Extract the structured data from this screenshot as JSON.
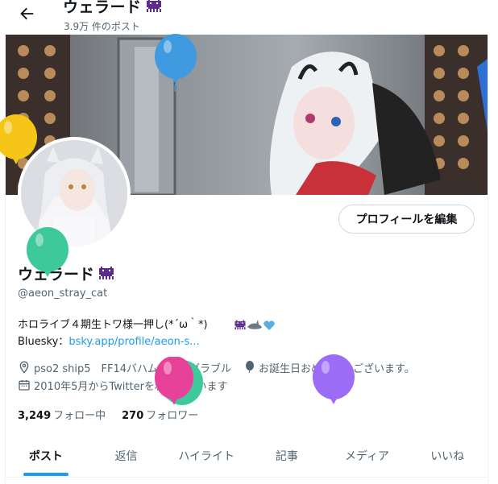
{
  "header": {
    "title": "ウェラード",
    "post_count": "3.9万 件のポスト"
  },
  "profile": {
    "name": "ウェラード",
    "handle": "@aeon_stray_cat",
    "edit_button": "プロフィールを編集"
  },
  "bio": {
    "line1": "ホロライブ４期生トワ様一押し(*´ω｀*)",
    "line2_prefix": "Bluesky：",
    "line2_link": "bsky.app/profile/aeon-s..."
  },
  "meta": {
    "location": "pso2 ship5　FF14バハムート　グラブル",
    "birthday": "お誕生日おめでとうございます。",
    "joined": "2010年5月からTwitterを利用しています"
  },
  "stats": {
    "following_count": "3,249",
    "following_label": "フォロー中",
    "followers_count": "270",
    "followers_label": "フォロワー"
  },
  "tabs": [
    {
      "label": "ポスト"
    },
    {
      "label": "返信"
    },
    {
      "label": "ハイライト"
    },
    {
      "label": "記事"
    },
    {
      "label": "メディア"
    },
    {
      "label": "いいね"
    }
  ],
  "icons": [
    "back-arrow-icon",
    "pixel-invader-icon",
    "location-icon",
    "birthday-balloon-icon",
    "calendar-icon",
    "shark-icon",
    "heart-icon",
    "balloon-icon"
  ],
  "colors": {
    "accent": "#1d9bf0",
    "text": "#0f1419",
    "muted": "#536471",
    "balloon_blue": "#3f9ae0",
    "balloon_yellow": "#f5c518",
    "balloon_green": "#3ec99a",
    "balloon_pink": "#e8419a",
    "balloon_purple": "#9b6cf5"
  }
}
